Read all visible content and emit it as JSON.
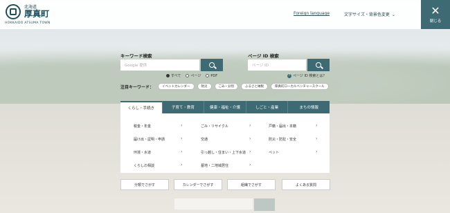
{
  "header": {
    "pref": "北海道",
    "town": "厚真町",
    "town_en": "HOKKAIDO ATSUMA TOWN",
    "lang_link": "Foreign language",
    "size_link": "文字サイズ・背景色変更",
    "close_label": "閉じる"
  },
  "keyword_search": {
    "label": "キーワード検索",
    "placeholder": "Google 提供"
  },
  "page_id_search": {
    "label": "ページ ID 検索",
    "placeholder": "ページ ID",
    "help": "ページ ID 検索とは？"
  },
  "radios": [
    {
      "label": "すべて",
      "checked": true
    },
    {
      "label": "ページ",
      "checked": false
    },
    {
      "label": "PDF",
      "checked": false
    }
  ],
  "hot_keywords": {
    "label": "注目キーワード：",
    "items": [
      "イベントカレンダー",
      "防災",
      "ごみ・分別",
      "ふるさと納税",
      "厚真町ローカルベンチャースクール"
    ]
  },
  "tabs": [
    "くらし・手続き",
    "子育て・教育",
    "健康・福祉・介護",
    "しごと・産業",
    "まちの情報"
  ],
  "panel_items": [
    [
      "税金・年金",
      "ごみ・リサイクル",
      "戸籍・届出・本籍"
    ],
    [
      "届け出・証明・申請",
      "交通",
      "防災・防犯・安全"
    ],
    [
      "环境・水道",
      "引っ越し・住まい・上下水道",
      "ペット"
    ],
    [
      "くらしの相談",
      "墓地・二地域居住",
      ""
    ]
  ],
  "bottom_buttons": [
    "分類でさがす",
    "カレンダーでさがす",
    "組織でさがす",
    "よくある質問"
  ],
  "colors": {
    "accent": "#3d6a73"
  }
}
